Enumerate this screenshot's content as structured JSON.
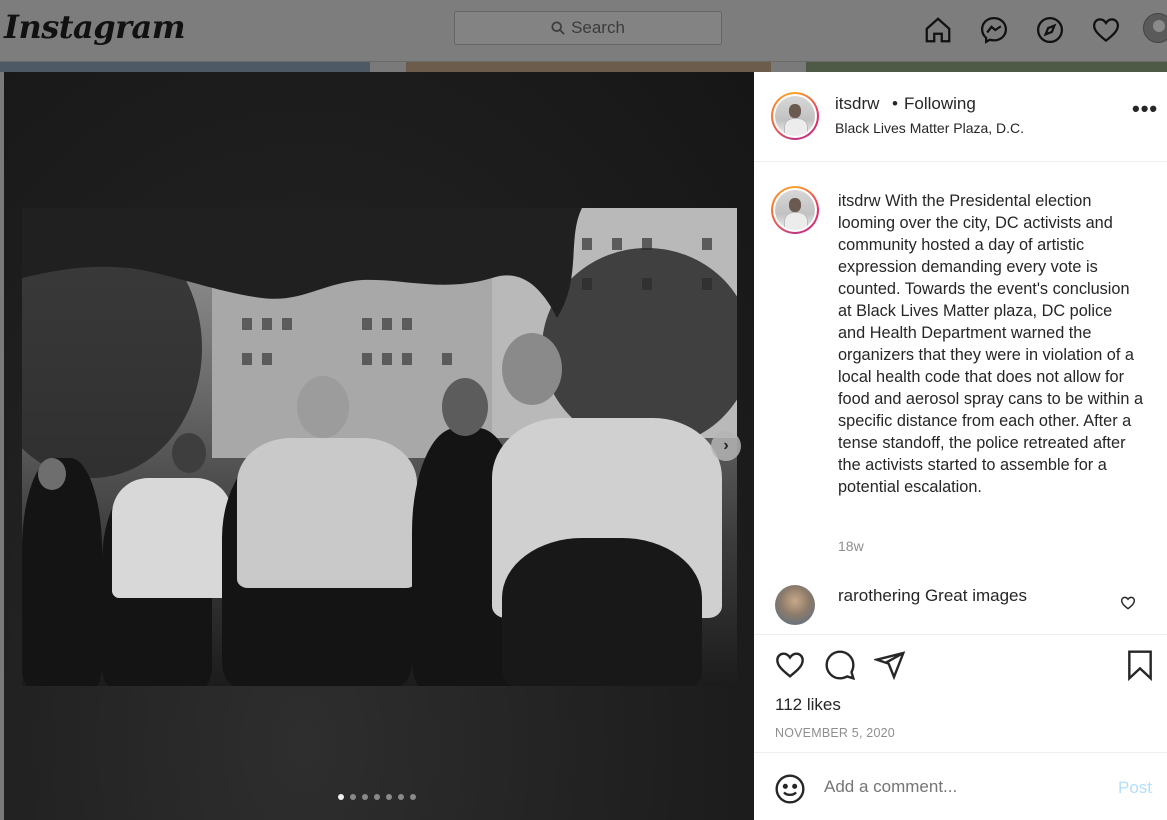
{
  "app": {
    "logo": "Instagram"
  },
  "search": {
    "placeholder": "Search"
  },
  "nav": {
    "icons": [
      "home-icon",
      "messenger-icon",
      "explore-icon",
      "activity-heart-icon",
      "profile-avatar"
    ]
  },
  "carousel": {
    "total_slides": 7,
    "active_slide": 1,
    "next_arrow": "›"
  },
  "post": {
    "username": "itsdrw",
    "separator": "•",
    "follow_status": "Following",
    "location": "Black Lives Matter Plaza, D.C.",
    "more": "•••",
    "caption_user": "itsdrw",
    "caption_text": "With the Presidental election looming over the city, DC activists and community hosted a day of artistic expression demanding every vote is counted. Towards the event's conclusion at Black Lives Matter plaza, DC police and Health Department warned the organizers that they were in violation of a local health code that does not allow for food and aerosol spray cans to be within a specific distance from each other. After a tense standoff, the police retreated after the activists started to assemble for a potential escalation.",
    "age": "18w",
    "likes": "112 likes",
    "date": "NOVEMBER 5, 2020"
  },
  "comments": [
    {
      "user": "rarothering",
      "text": "Great images"
    }
  ],
  "add_comment": {
    "placeholder": "Add a comment...",
    "post_label": "Post"
  },
  "colors": {
    "overlay_dim": "#7d7d7d",
    "text": "#262626",
    "muted": "#8e8e8e",
    "post_disabled": "#b2dffc"
  }
}
